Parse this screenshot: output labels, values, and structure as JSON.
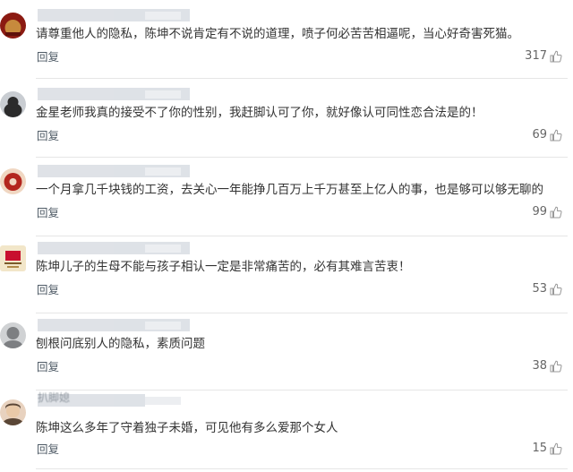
{
  "comments": [
    {
      "avatar_icon": "user-avatar-red-badge",
      "avatar_colors": [
        "#8b1a12",
        "#c78a3d"
      ],
      "name_visible": "",
      "text": "请尊重他人的隐私，陈坤不说肯定有不说的道理，喷子何必苦苦相逼呢，当心好奇害死猫。",
      "reply_label": "回复",
      "likes": "317"
    },
    {
      "avatar_icon": "user-avatar-black-cat",
      "avatar_colors": [
        "#2b2b2b",
        "#c9cdd2"
      ],
      "name_visible": "",
      "text": "金星老师我真的接受不了你的性别，我赶脚认可了你，就好像认可同性恋合法是的！",
      "reply_label": "回复",
      "likes": "69"
    },
    {
      "avatar_icon": "user-avatar-red-circle",
      "avatar_colors": [
        "#b3261e",
        "#f0d7c2"
      ],
      "name_visible": "",
      "text": "一个月拿几千块钱的工资，去关心一年能挣几百万上千万甚至上亿人的事，也是够可以够无聊的",
      "reply_label": "回复",
      "likes": "99"
    },
    {
      "avatar_icon": "user-avatar-self-reliance-logo",
      "avatar_colors": [
        "#c8102e",
        "#f2e6c9"
      ],
      "name_visible": "",
      "text": "陈坤儿子的生母不能与孩子相认一定是非常痛苦的，必有其难言苦衷！",
      "reply_label": "回复",
      "likes": "53"
    },
    {
      "avatar_icon": "user-avatar-gray-face",
      "avatar_colors": [
        "#7d7f82",
        "#d0d2d4"
      ],
      "name_visible": "",
      "text": "刨根问底别人的隐私，素质问题",
      "reply_label": "回复",
      "likes": "38"
    },
    {
      "avatar_icon": "user-avatar-portrait",
      "avatar_colors": [
        "#5a4636",
        "#e8d2bf"
      ],
      "name_visible": "扒脚媳",
      "text": "陈坤这么多年了守着独子未婚，可见他有多么爱那个女人",
      "reply_label": "回复",
      "likes": "15"
    }
  ],
  "like_icon": "thumbs-up-icon"
}
